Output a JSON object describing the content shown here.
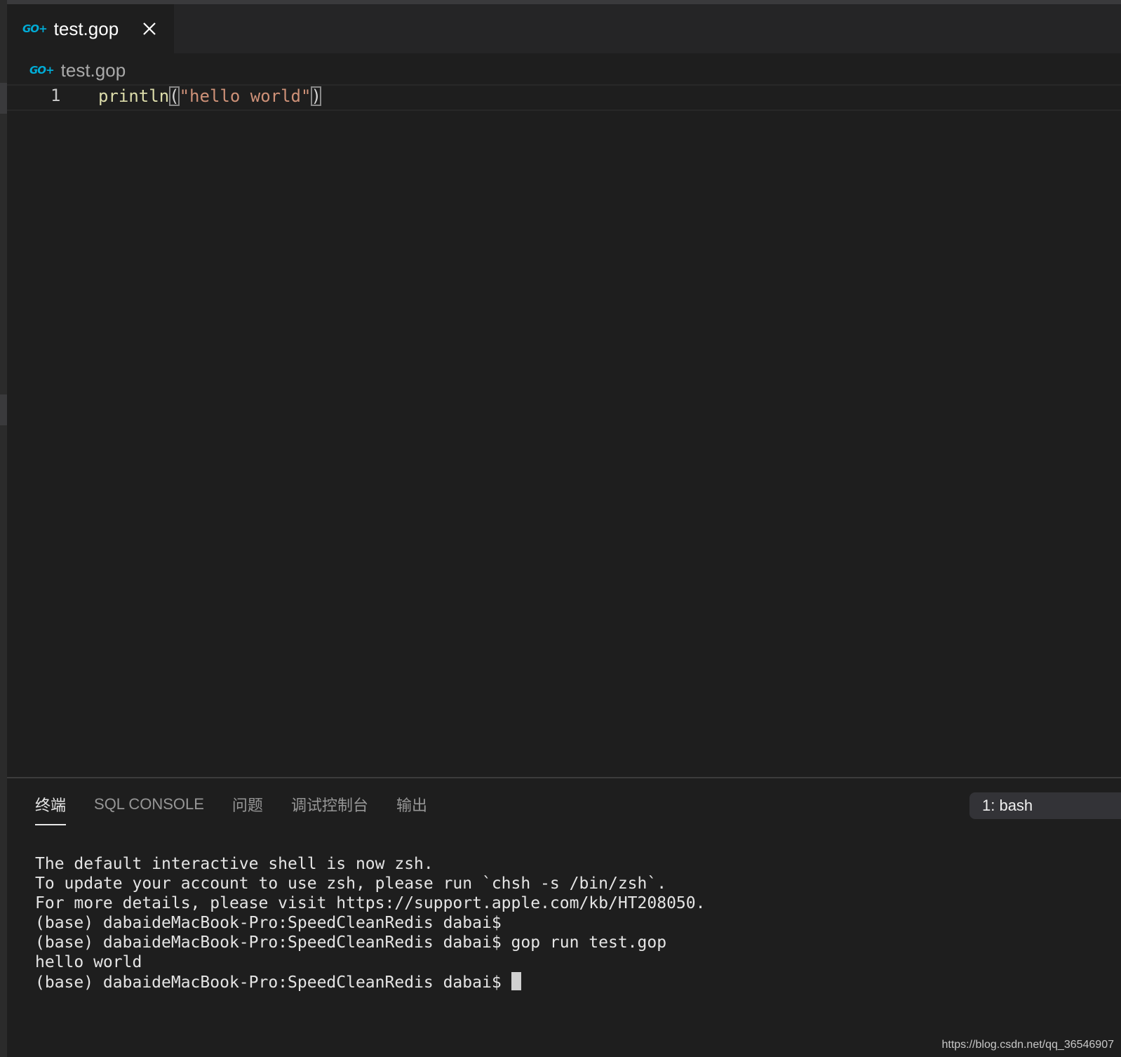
{
  "tabs": [
    {
      "label": "test.gop",
      "icon": "go-plus-icon",
      "close_icon": "close-icon"
    }
  ],
  "breadcrumb": {
    "label": "test.gop",
    "icon": "go-plus-icon"
  },
  "logo_text": "GO+",
  "editor": {
    "lines": [
      {
        "number": "1",
        "tokens": {
          "fn": "println",
          "open": "(",
          "str": "\"hello world\"",
          "close": ")"
        }
      }
    ]
  },
  "panel": {
    "tabs": [
      {
        "label": "终端",
        "active": true
      },
      {
        "label": "SQL CONSOLE",
        "active": false
      },
      {
        "label": "问题",
        "active": false
      },
      {
        "label": "调试控制台",
        "active": false
      },
      {
        "label": "输出",
        "active": false
      }
    ],
    "terminal_selector": "1: bash",
    "terminal_lines": [
      "The default interactive shell is now zsh.",
      "To update your account to use zsh, please run `chsh -s /bin/zsh`.",
      "For more details, please visit https://support.apple.com/kb/HT208050.",
      "(base) dabaideMacBook-Pro:SpeedCleanRedis dabai$",
      "(base) dabaideMacBook-Pro:SpeedCleanRedis dabai$ gop run test.gop",
      "hello world"
    ],
    "terminal_prompt": "(base) dabaideMacBook-Pro:SpeedCleanRedis dabai$ "
  },
  "watermark": "https://blog.csdn.net/qq_36546907",
  "colors": {
    "background": "#1e1e1e",
    "tab_bar": "#252526",
    "go_blue": "#00acd7",
    "function": "#dcdcaa",
    "string": "#ce9178"
  }
}
